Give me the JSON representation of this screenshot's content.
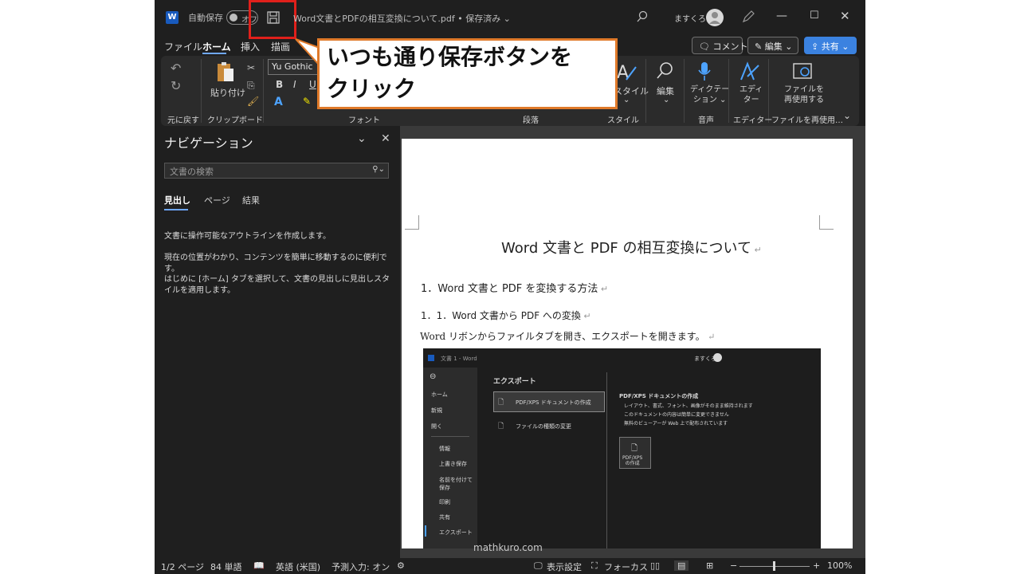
{
  "titlebar": {
    "autosave_label": "自動保存",
    "autosave_state": "オフ",
    "doc_title": "Word文書とPDFの相互変換について.pdf • 保存済み ⌄",
    "user_name": "ますくろ"
  },
  "tabs": [
    "ファイル",
    "ホーム",
    "挿入",
    "描画"
  ],
  "top_buttons": {
    "comment": "コメント",
    "edit": "編集 ⌄",
    "share": "共有 ⌄"
  },
  "ribbon": {
    "font_name": "Yu Gothic",
    "paste_label": "貼り付け",
    "style_label": "スタイル",
    "edit_label": "編集",
    "dictate_label": "ディクテー\nション ⌄",
    "editor_label": "エディ\nター",
    "reuse_label": "ファイルを\n再使用する",
    "groups": {
      "undo": "元に戻す",
      "clipboard": "クリップボード",
      "font": "フォント",
      "paragraph": "段落",
      "style": "スタイル",
      "voice": "音声",
      "editor": "エディター",
      "reuse": "ファイルを再使用…"
    }
  },
  "callout": {
    "line1": "いつも通り保存ボタンを",
    "line2": "クリック"
  },
  "nav": {
    "title": "ナビゲーション",
    "search_placeholder": "文書の検索",
    "tabs": [
      "見出し",
      "ページ",
      "結果"
    ],
    "text1": "文書に操作可能なアウトラインを作成します。",
    "text2": "現在の位置がわかり、コンテンツを簡単に移動するのに便利です。",
    "text3": "はじめに [ホーム] タブを選択して、文書の見出しに見出しスタイルを適用します。"
  },
  "document": {
    "title": "Word 文書と PDF の相互変換について",
    "h1": "1．Word 文書と PDF を変換する方法",
    "h2": "1．1．Word 文書から PDF への変換",
    "body": "Word リボンからファイルタブを開き、エクスポートを開きます。",
    "embedded": {
      "title_bar": "文書 1 - Word",
      "user": "ますくろ",
      "sidebar": [
        "ホーム",
        "新規",
        "開く",
        "情報",
        "上書き保存",
        "名前を付けて保存",
        "印刷",
        "共有",
        "エクスポート"
      ],
      "heading": "エクスポート",
      "option1": "PDF/XPS ドキュメントの作成",
      "option2": "ファイルの種類の変更",
      "detail_title": "PDF/XPS ドキュメントの作成",
      "bullets": [
        "レイアウト、書式、フォント、画像がそのまま維持されます",
        "このドキュメントの内容は簡単に変更できません",
        "無料のビューアーが Web 上で配布されています"
      ],
      "create_button": "PDF/XPS\nの作成"
    }
  },
  "statusbar": {
    "page": "1/2 ページ",
    "words": "84 単語",
    "language": "英語 (米国)",
    "predict": "予測入力: オン",
    "display": "表示設定",
    "focus": "フォーカス",
    "zoom": "100%"
  },
  "watermark": "mathkuro.com",
  "colors": {
    "accent": "#3b82e0",
    "highlight_box": "#e0201b",
    "callout_border": "#e07a2a"
  }
}
